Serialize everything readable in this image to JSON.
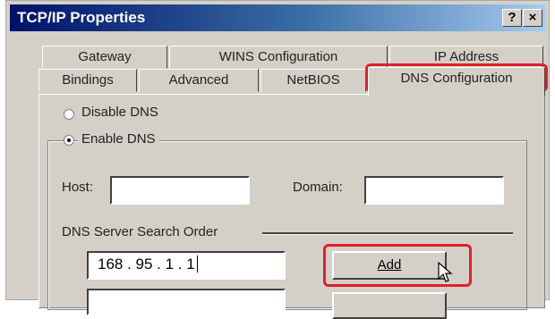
{
  "window": {
    "title": "TCP/IP Properties",
    "help_glyph": "?",
    "close_glyph": "×"
  },
  "tabs": {
    "row_back": [
      "Gateway",
      "WINS Configuration",
      "IP Address"
    ],
    "row_front": [
      "Bindings",
      "Advanced",
      "NetBIOS",
      "DNS Configuration"
    ]
  },
  "dns": {
    "disable_label": "Disable DNS",
    "enable_label": "Enable DNS",
    "host_label": "Host:",
    "domain_label": "Domain:",
    "host_value": "",
    "domain_value": "",
    "search_order_label": "DNS Server Search Order",
    "server_value": "168 . 95 . 1 . 1",
    "add_label": "Add"
  },
  "colors": {
    "highlight": "#e0202a",
    "title_start": "#00106a",
    "title_end": "#a6caf0"
  }
}
